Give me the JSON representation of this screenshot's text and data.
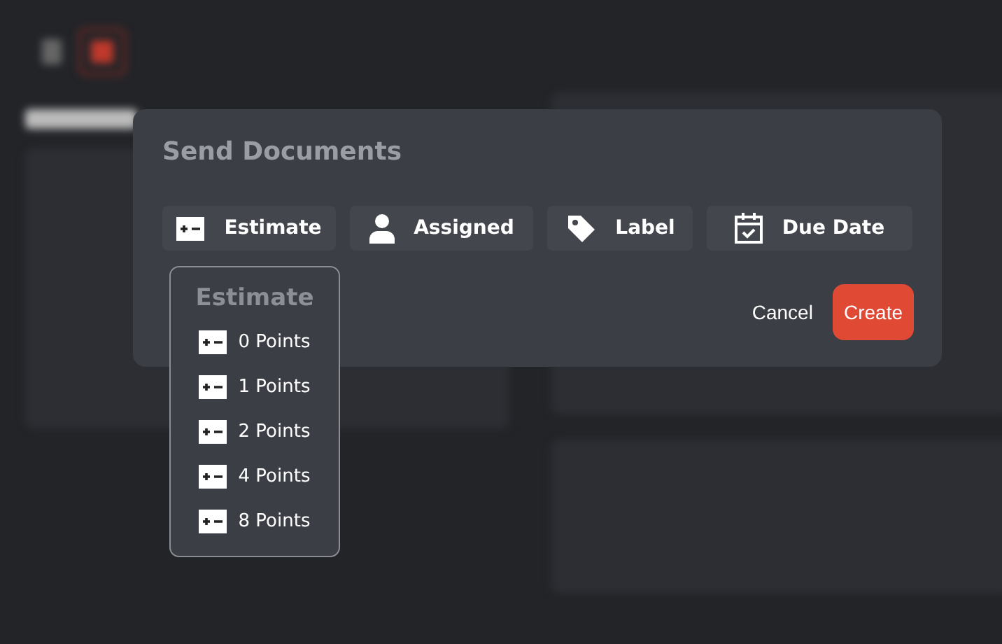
{
  "dialog": {
    "title": "Send Documents",
    "fields": [
      {
        "kind": "estimate",
        "label": "Estimate"
      },
      {
        "kind": "assigned",
        "label": "Assigned"
      },
      {
        "kind": "label",
        "label": "Label"
      },
      {
        "kind": "due_date",
        "label": "Due Date"
      }
    ],
    "buttons": [
      {
        "kind": "plain",
        "label": "Cancel"
      },
      {
        "kind": "primary",
        "label": "Create"
      }
    ]
  },
  "estimate_menu": {
    "title": "Estimate",
    "options": [
      {
        "label": "0 Points"
      },
      {
        "label": "1 Points"
      },
      {
        "label": "2 Points"
      },
      {
        "label": "4 Points"
      },
      {
        "label": "8 Points"
      }
    ]
  }
}
